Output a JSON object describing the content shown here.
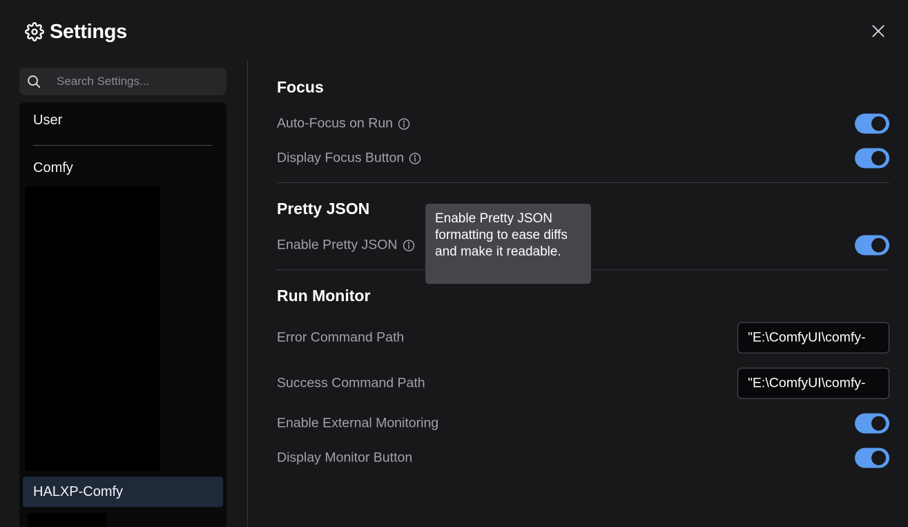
{
  "header": {
    "title": "Settings"
  },
  "search": {
    "placeholder": "Search Settings..."
  },
  "sidebar": {
    "items": [
      {
        "label": "User"
      },
      {
        "label": "Comfy"
      },
      {
        "label": "HALXP-Comfy",
        "active": true
      }
    ]
  },
  "sections": {
    "focus": {
      "title": "Focus",
      "auto_focus_label": "Auto-Focus on Run",
      "auto_focus_on": true,
      "display_focus_label": "Display Focus Button",
      "display_focus_on": true
    },
    "pretty_json": {
      "title": "Pretty JSON",
      "enable_label": "Enable Pretty JSON",
      "enable_on": true
    },
    "run_monitor": {
      "title": "Run Monitor",
      "error_path_label": "Error Command Path",
      "error_path_value": "\"E:\\ComfyUI\\comfy-",
      "success_path_label": "Success Command Path",
      "success_path_value": "\"E:\\ComfyUI\\comfy-",
      "external_label": "Enable External Monitoring",
      "external_on": true,
      "monitor_button_label": "Display Monitor Button",
      "monitor_button_on": true
    }
  },
  "tooltip": {
    "text": "Enable Pretty JSON formatting to ease diffs and make it readable."
  },
  "colors": {
    "background": "#18181b",
    "toggle_on": "#5b9cf0",
    "active_nav": "#1e2a3a",
    "tooltip_bg": "#45454b"
  }
}
